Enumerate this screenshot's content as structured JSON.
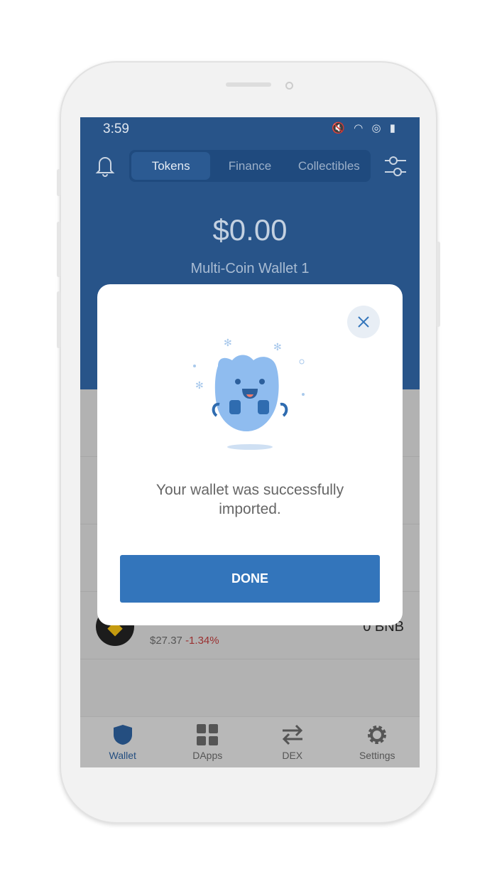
{
  "status_bar": {
    "time": "3:59",
    "right_icons": "🔇 wifi volte signal battery"
  },
  "header": {
    "tabs": [
      {
        "label": "Tokens",
        "active": true
      },
      {
        "label": "Finance"
      },
      {
        "label": "Collectibles"
      }
    ],
    "balance": "$0.00",
    "wallet_name": "Multi-Coin Wallet 1"
  },
  "tokens": [
    {
      "symbol": "BNB",
      "price": "$27.37",
      "change": "-1.34%",
      "amount": "0 BNB"
    }
  ],
  "modal": {
    "message": "Your wallet was successfully imported.",
    "done_label": "DONE"
  },
  "nav": [
    {
      "label": "Wallet",
      "icon": "shield-icon",
      "active": true
    },
    {
      "label": "DApps",
      "icon": "grid-icon"
    },
    {
      "label": "DEX",
      "icon": "swap-icon"
    },
    {
      "label": "Settings",
      "icon": "gear-icon"
    }
  ],
  "colors": {
    "header": "#285489",
    "accent": "#3375bb",
    "negative": "#9a3030"
  }
}
